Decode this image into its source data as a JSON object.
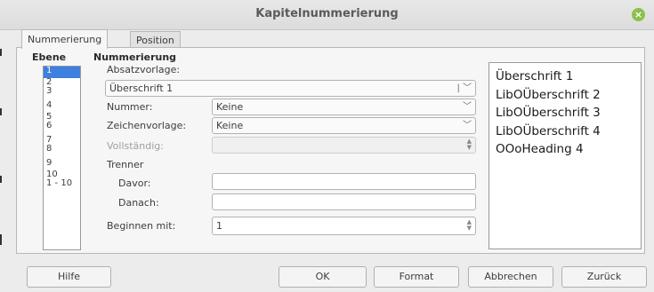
{
  "window": {
    "title": "Kapitelnummerierung"
  },
  "tabs": [
    {
      "label": "Nummerierung",
      "active": true
    },
    {
      "label": "Position",
      "active": false
    }
  ],
  "level_section": {
    "heading": "Ebene",
    "items": [
      "1",
      "2\n3",
      "4",
      "5\n6",
      "7\n8",
      "9",
      "10\n1 - 10"
    ],
    "selected": "1"
  },
  "numbering": {
    "heading": "Nummerierung",
    "paragraph_style_label": "Absatzvorlage:",
    "paragraph_style_value": "Überschrift 1",
    "number_label": "Nummer:",
    "number_value": "Keine",
    "char_style_label": "Zeichenvorlage:",
    "char_style_value": "Keine",
    "complete_label": "Vollständig:",
    "separator_heading": "Trenner",
    "before_label": "Davor:",
    "after_label": "Danach:",
    "start_label": "Beginnen mit:",
    "start_value": "1"
  },
  "preview": {
    "lines": [
      "Überschrift 1",
      "LibOÜberschrift 2",
      "LibOÜberschrift 3",
      "LibOÜberschrift 4",
      "OOoHeading 4"
    ]
  },
  "buttons": {
    "help": "Hilfe",
    "ok": "OK",
    "format": "Format",
    "cancel": "Abbrechen",
    "back": "Zurück"
  },
  "colors": {
    "selection": "#3d80df",
    "close_button": "#8cc04a"
  },
  "icons": {
    "close": "close-icon",
    "dropdown": "chevron-down-icon",
    "spin": "spin-arrows-icon"
  }
}
